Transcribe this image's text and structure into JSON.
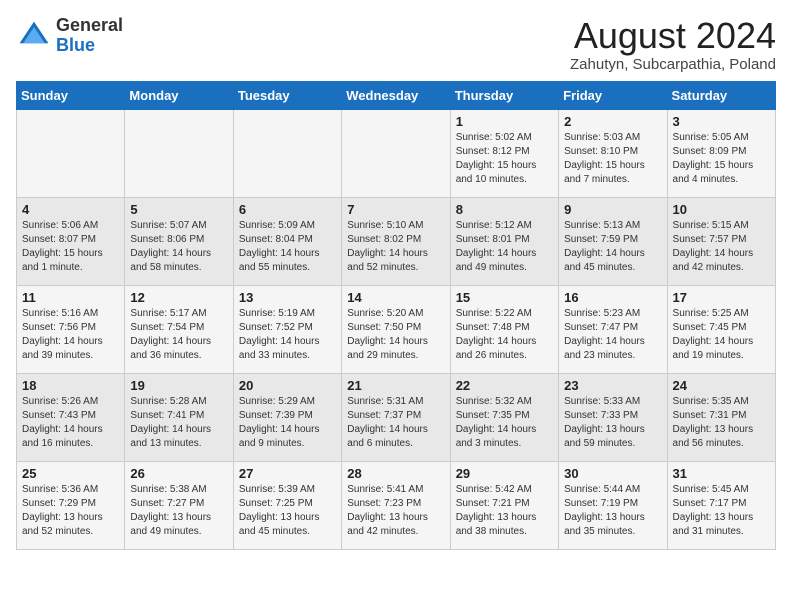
{
  "logo": {
    "general": "General",
    "blue": "Blue"
  },
  "title": {
    "month_year": "August 2024",
    "location": "Zahutyn, Subcarpathia, Poland"
  },
  "weekdays": [
    "Sunday",
    "Monday",
    "Tuesday",
    "Wednesday",
    "Thursday",
    "Friday",
    "Saturday"
  ],
  "weeks": [
    [
      {
        "day": "",
        "info": ""
      },
      {
        "day": "",
        "info": ""
      },
      {
        "day": "",
        "info": ""
      },
      {
        "day": "",
        "info": ""
      },
      {
        "day": "1",
        "info": "Sunrise: 5:02 AM\nSunset: 8:12 PM\nDaylight: 15 hours\nand 10 minutes."
      },
      {
        "day": "2",
        "info": "Sunrise: 5:03 AM\nSunset: 8:10 PM\nDaylight: 15 hours\nand 7 minutes."
      },
      {
        "day": "3",
        "info": "Sunrise: 5:05 AM\nSunset: 8:09 PM\nDaylight: 15 hours\nand 4 minutes."
      }
    ],
    [
      {
        "day": "4",
        "info": "Sunrise: 5:06 AM\nSunset: 8:07 PM\nDaylight: 15 hours\nand 1 minute."
      },
      {
        "day": "5",
        "info": "Sunrise: 5:07 AM\nSunset: 8:06 PM\nDaylight: 14 hours\nand 58 minutes."
      },
      {
        "day": "6",
        "info": "Sunrise: 5:09 AM\nSunset: 8:04 PM\nDaylight: 14 hours\nand 55 minutes."
      },
      {
        "day": "7",
        "info": "Sunrise: 5:10 AM\nSunset: 8:02 PM\nDaylight: 14 hours\nand 52 minutes."
      },
      {
        "day": "8",
        "info": "Sunrise: 5:12 AM\nSunset: 8:01 PM\nDaylight: 14 hours\nand 49 minutes."
      },
      {
        "day": "9",
        "info": "Sunrise: 5:13 AM\nSunset: 7:59 PM\nDaylight: 14 hours\nand 45 minutes."
      },
      {
        "day": "10",
        "info": "Sunrise: 5:15 AM\nSunset: 7:57 PM\nDaylight: 14 hours\nand 42 minutes."
      }
    ],
    [
      {
        "day": "11",
        "info": "Sunrise: 5:16 AM\nSunset: 7:56 PM\nDaylight: 14 hours\nand 39 minutes."
      },
      {
        "day": "12",
        "info": "Sunrise: 5:17 AM\nSunset: 7:54 PM\nDaylight: 14 hours\nand 36 minutes."
      },
      {
        "day": "13",
        "info": "Sunrise: 5:19 AM\nSunset: 7:52 PM\nDaylight: 14 hours\nand 33 minutes."
      },
      {
        "day": "14",
        "info": "Sunrise: 5:20 AM\nSunset: 7:50 PM\nDaylight: 14 hours\nand 29 minutes."
      },
      {
        "day": "15",
        "info": "Sunrise: 5:22 AM\nSunset: 7:48 PM\nDaylight: 14 hours\nand 26 minutes."
      },
      {
        "day": "16",
        "info": "Sunrise: 5:23 AM\nSunset: 7:47 PM\nDaylight: 14 hours\nand 23 minutes."
      },
      {
        "day": "17",
        "info": "Sunrise: 5:25 AM\nSunset: 7:45 PM\nDaylight: 14 hours\nand 19 minutes."
      }
    ],
    [
      {
        "day": "18",
        "info": "Sunrise: 5:26 AM\nSunset: 7:43 PM\nDaylight: 14 hours\nand 16 minutes."
      },
      {
        "day": "19",
        "info": "Sunrise: 5:28 AM\nSunset: 7:41 PM\nDaylight: 14 hours\nand 13 minutes."
      },
      {
        "day": "20",
        "info": "Sunrise: 5:29 AM\nSunset: 7:39 PM\nDaylight: 14 hours\nand 9 minutes."
      },
      {
        "day": "21",
        "info": "Sunrise: 5:31 AM\nSunset: 7:37 PM\nDaylight: 14 hours\nand 6 minutes."
      },
      {
        "day": "22",
        "info": "Sunrise: 5:32 AM\nSunset: 7:35 PM\nDaylight: 14 hours\nand 3 minutes."
      },
      {
        "day": "23",
        "info": "Sunrise: 5:33 AM\nSunset: 7:33 PM\nDaylight: 13 hours\nand 59 minutes."
      },
      {
        "day": "24",
        "info": "Sunrise: 5:35 AM\nSunset: 7:31 PM\nDaylight: 13 hours\nand 56 minutes."
      }
    ],
    [
      {
        "day": "25",
        "info": "Sunrise: 5:36 AM\nSunset: 7:29 PM\nDaylight: 13 hours\nand 52 minutes."
      },
      {
        "day": "26",
        "info": "Sunrise: 5:38 AM\nSunset: 7:27 PM\nDaylight: 13 hours\nand 49 minutes."
      },
      {
        "day": "27",
        "info": "Sunrise: 5:39 AM\nSunset: 7:25 PM\nDaylight: 13 hours\nand 45 minutes."
      },
      {
        "day": "28",
        "info": "Sunrise: 5:41 AM\nSunset: 7:23 PM\nDaylight: 13 hours\nand 42 minutes."
      },
      {
        "day": "29",
        "info": "Sunrise: 5:42 AM\nSunset: 7:21 PM\nDaylight: 13 hours\nand 38 minutes."
      },
      {
        "day": "30",
        "info": "Sunrise: 5:44 AM\nSunset: 7:19 PM\nDaylight: 13 hours\nand 35 minutes."
      },
      {
        "day": "31",
        "info": "Sunrise: 5:45 AM\nSunset: 7:17 PM\nDaylight: 13 hours\nand 31 minutes."
      }
    ]
  ]
}
